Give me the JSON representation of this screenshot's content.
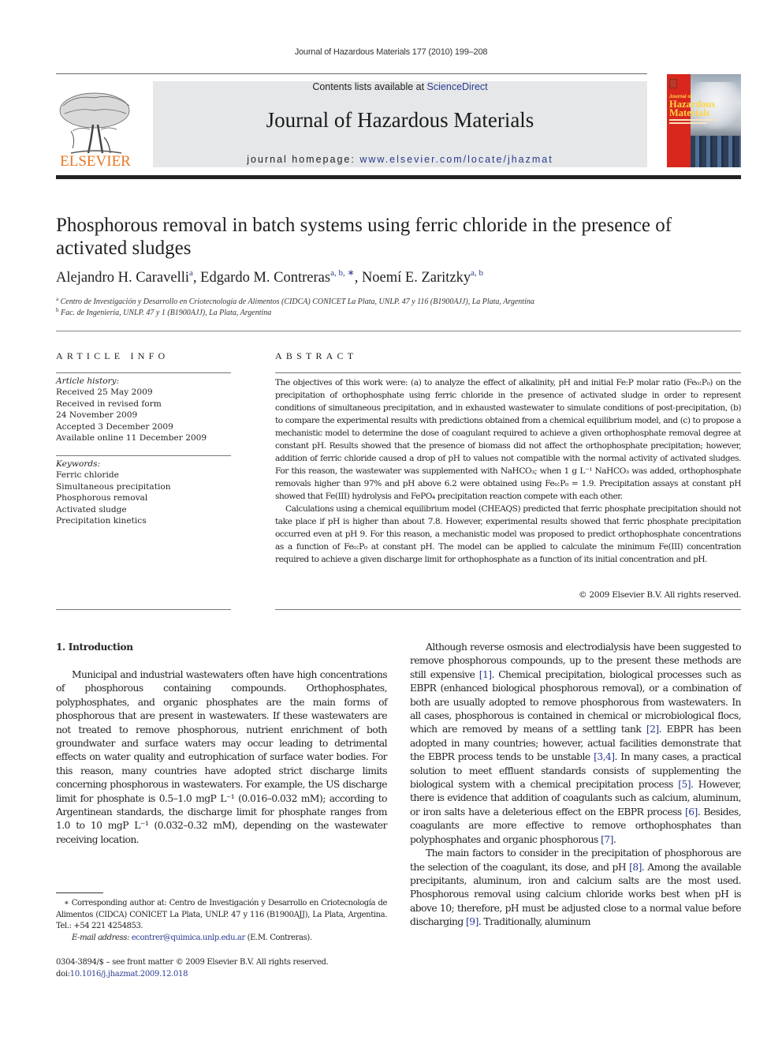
{
  "running_head": "Journal of Hazardous Materials 177 (2010) 199–208",
  "masthead": {
    "publisher_logo_text": "ELSEVIER",
    "contents_prefix": "Contents lists available at ",
    "contents_link": "ScienceDirect",
    "journal_title": "Journal of Hazardous Materials",
    "homepage_prefix": "journal homepage: ",
    "homepage_link": "www.elsevier.com/locate/jhazmat",
    "cover": {
      "line1": "Journal of",
      "line2": "Hazardous",
      "line3": "Materials",
      "accent_color": "#d9271e",
      "title_color": "#ffd640"
    },
    "band_color": "#e6e7e8",
    "logo_color": "#e87722"
  },
  "article": {
    "title": "Phosphorous removal in batch systems using ferric chloride in the presence of activated sludges",
    "authors": [
      {
        "name": "Alejandro H. Caravelli",
        "sup": "a"
      },
      {
        "name": "Edgardo M. Contreras",
        "sup": "a, b, ∗"
      },
      {
        "name": "Noemí E. Zaritzky",
        "sup": "a, b"
      }
    ],
    "affiliations": [
      {
        "mark": "a",
        "text": "Centro de Investigación y Desarrollo en Criotecnología de Alimentos (CIDCA) CONICET La Plata, UNLP. 47 y 116 (B1900AJJ), La Plata, Argentina"
      },
      {
        "mark": "b",
        "text": "Fac. de Ingeniería, UNLP. 47 y 1 (B1900AJJ), La Plata, Argentina"
      }
    ]
  },
  "article_info": {
    "heading": "ARTICLE INFO",
    "history_label": "Article history:",
    "history": [
      "Received 25 May 2009",
      "Received in revised form",
      "24 November 2009",
      "Accepted 3 December 2009",
      "Available online 11 December 2009"
    ],
    "keywords_label": "Keywords:",
    "keywords": [
      "Ferric chloride",
      "Simultaneous precipitation",
      "Phosphorous removal",
      "Activated sludge",
      "Precipitation kinetics"
    ]
  },
  "abstract": {
    "heading": "ABSTRACT",
    "p1": "The objectives of this work were: (a) to analyze the effect of alkalinity, pH and initial Fe:P molar ratio (Fe₀:P₀) on the precipitation of orthophosphate using ferric chloride in the presence of activated sludge in order to represent conditions of simultaneous precipitation, and in exhausted wastewater to simulate conditions of post-precipitation, (b) to compare the experimental results with predictions obtained from a chemical equilibrium model, and (c) to propose a mechanistic model to determine the dose of coagulant required to achieve a given orthophosphate removal degree at constant pH. Results showed that the presence of biomass did not affect the orthophosphate precipitation; however, addition of ferric chloride caused a drop of pH to values not compatible with the normal activity of activated sludges. For this reason, the wastewater was supplemented with NaHCO₃; when 1 g L⁻¹ NaHCO₃ was added, orthophosphate removals higher than 97% and pH above 6.2 were obtained using Fe₀:P₀ = 1.9. Precipitation assays at constant pH showed that Fe(III) hydrolysis and FePO₄ precipitation reaction compete with each other.",
    "p2": "Calculations using a chemical equilibrium model (CHEAQS) predicted that ferric phosphate precipitation should not take place if pH is higher than about 7.8. However, experimental results showed that ferric phosphate precipitation occurred even at pH 9. For this reason, a mechanistic model was proposed to predict orthophosphate concentrations as a function of Fe₀:P₀ at constant pH. The model can be applied to calculate the minimum Fe(III) concentration required to achieve a given discharge limit for orthophosphate as a function of its initial concentration and pH.",
    "copyright": "© 2009 Elsevier B.V. All rights reserved."
  },
  "introduction": {
    "heading": "1.  Introduction",
    "left_p1": "Municipal and industrial wastewaters often have high concentrations of phosphorous containing compounds. Orthophosphates, polyphosphates, and organic phosphates are the main forms of phosphorous that are present in wastewaters. If these wastewaters are not treated to remove phosphorous, nutrient enrichment of both groundwater and surface waters may occur leading to detrimental effects on water quality and eutrophication of surface water bodies. For this reason, many countries have adopted strict discharge limits concerning phosphorous in wastewaters. For example, the US discharge limit for phosphate is 0.5–1.0 mgP L⁻¹ (0.016–0.032 mM); according to Argentinean standards, the discharge limit for phosphate ranges from 1.0 to 10 mgP L⁻¹ (0.032–0.32 mM), depending on the wastewater receiving location.",
    "right_p1": [
      {
        "t": "Although reverse osmosis and electrodialysis have been suggested to remove phosphorous compounds, up to the present these methods are still expensive "
      },
      {
        "ref": "[1]"
      },
      {
        "t": ". Chemical precipitation, biological processes such as EBPR (enhanced biological phosphorous removal), or a combination of both are usually adopted to remove phosphorous from wastewaters. In all cases, phosphorous is contained in chemical or microbiological flocs, which are removed by means of a settling tank "
      },
      {
        "ref": "[2]"
      },
      {
        "t": ". EBPR has been adopted in many countries; however, actual facilities demonstrate that the EBPR process tends to be unstable "
      },
      {
        "ref": "[3,4]"
      },
      {
        "t": ". In many cases, a practical solution to meet effluent standards consists of supplementing the biological system with a chemical precipitation process "
      },
      {
        "ref": "[5]"
      },
      {
        "t": ". However, there is evidence that addition of coagulants such as calcium, aluminum, or iron salts have a deleterious effect on the EBPR process "
      },
      {
        "ref": "[6]"
      },
      {
        "t": ". Besides, coagulants are more effective to remove orthophosphates than polyphosphates and organic phosphorous "
      },
      {
        "ref": "[7]"
      },
      {
        "t": "."
      }
    ],
    "right_p2": [
      {
        "t": "The main factors to consider in the precipitation of phosphorous are the selection of the coagulant, its dose, and pH "
      },
      {
        "ref": "[8]"
      },
      {
        "t": ". Among the available precipitants, aluminum, iron and calcium salts are the most used. Phosphorous removal using calcium chloride works best when pH is above 10; therefore, pH must be adjusted close to a normal value before discharging "
      },
      {
        "ref": "[9]"
      },
      {
        "t": ". Traditionally, aluminum"
      }
    ]
  },
  "footnote": {
    "corresponding": "∗ Corresponding author at: Centro de Investigación y Desarrollo en Criotecnología de Alimentos (CIDCA) CONICET La Plata, UNLP. 47 y 116 (B1900AJJ), La Plata, Argentina. Tel.: +54 221 4254853.",
    "email_label": "E-mail address: ",
    "email": "econtrer@quimica.unlp.edu.ar",
    "email_suffix": " (E.M. Contreras).",
    "issn_line": "0304-3894/$ – see front matter © 2009 Elsevier B.V. All rights reserved.",
    "doi_prefix": "doi:",
    "doi": "10.1016/j.jhazmat.2009.12.018"
  },
  "colors": {
    "link": "#2a3b8f",
    "text": "#1a1a1a"
  }
}
